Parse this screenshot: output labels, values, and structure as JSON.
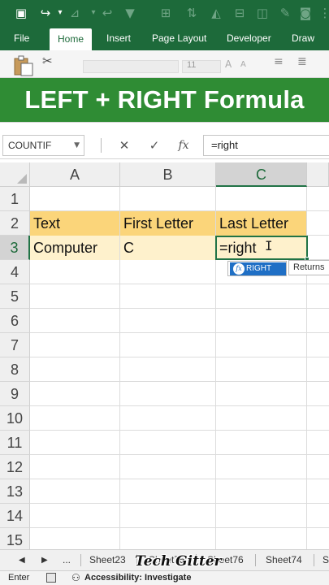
{
  "banner": {
    "title": "LEFT + RIGHT Formula"
  },
  "ribbon": {
    "tabs": [
      "File",
      "Home",
      "Insert",
      "Page Layout",
      "Developer",
      "Draw"
    ],
    "active_tab": "Home",
    "font_size": "11"
  },
  "quick_access": {
    "icons": [
      "save-icon",
      "redo-icon",
      "undo-icon",
      "chart-icon",
      "filter-icon",
      "sort-icon",
      "table-icon",
      "shapes-icon",
      "camera-icon",
      "more-icon"
    ]
  },
  "formula_bar": {
    "name_box": "COUNTIF",
    "cancel_glyph": "✕",
    "enter_glyph": "✓",
    "fx_label": "fx",
    "formula": "=right"
  },
  "grid": {
    "columns": [
      "A",
      "B",
      "C"
    ],
    "rows": [
      "1",
      "2",
      "3",
      "4",
      "5",
      "6",
      "7",
      "8",
      "9",
      "10",
      "11",
      "12",
      "13",
      "14",
      "15"
    ],
    "active_column": "C",
    "active_row": "3",
    "cells": {
      "A2": "Text",
      "B2": "First Letter",
      "C2": "Last Letter",
      "A3": "Computer",
      "B3": "C",
      "C3": "=right"
    }
  },
  "autocomplete": {
    "item": "RIGHT",
    "tooltip": "Returns"
  },
  "sheet_tabs": {
    "nav_prev": "◀",
    "nav_next": "▶",
    "ellipsis": "...",
    "tabs": [
      "Sheet23",
      "Sheet75",
      "Sheet76",
      "Sheet74",
      "S"
    ]
  },
  "watermark": "Tech Gitter",
  "status_bar": {
    "mode": "Enter",
    "accessibility": "Accessibility: Investigate"
  },
  "colors": {
    "ribbon_green": "#1d6a3a",
    "banner_green": "#2f8c34",
    "header_fill": "#fbd57a",
    "data_fill": "#fef1cc",
    "selection": "#217346",
    "autocomplete_highlight": "#1f6fc5"
  }
}
